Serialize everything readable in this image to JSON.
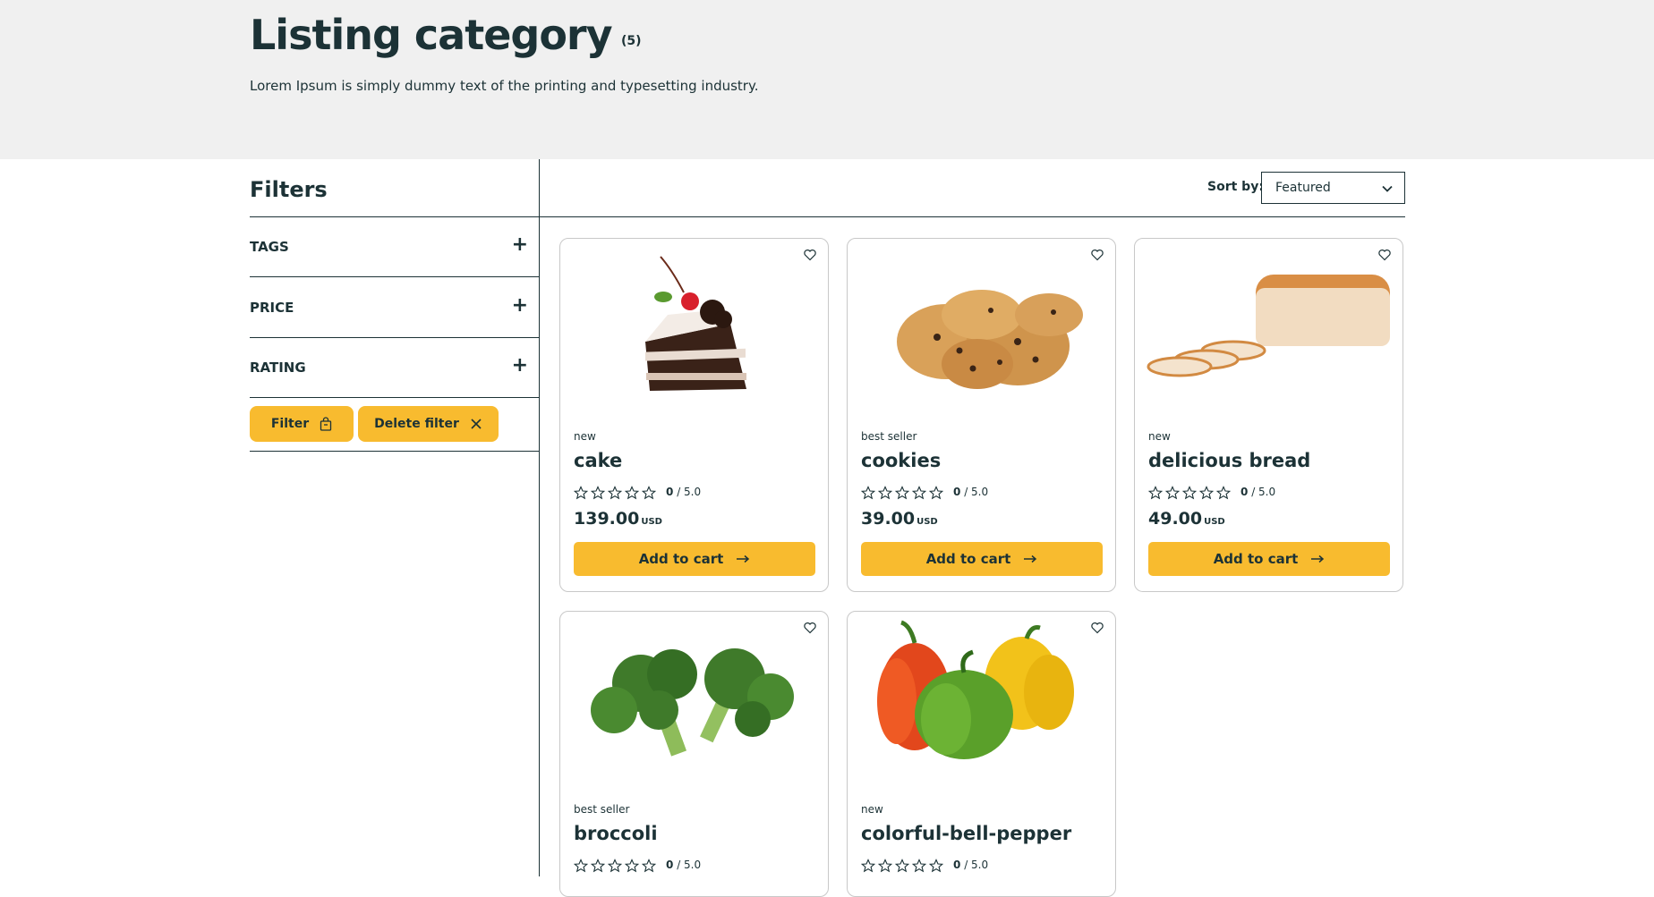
{
  "header": {
    "title": "Listing category",
    "count": "(5)",
    "description": "Lorem Ipsum is simply dummy text of the printing and typesetting industry."
  },
  "filters": {
    "title": "Filters",
    "sections": [
      {
        "label": "TAGS",
        "icon": "plus-icon"
      },
      {
        "label": "PRICE",
        "icon": "plus-icon"
      },
      {
        "label": "RATING",
        "icon": "plus-icon"
      }
    ],
    "filter_button": "Filter",
    "delete_button": "Delete filter"
  },
  "sort": {
    "label": "Sort by:",
    "selected": "Featured"
  },
  "products": [
    {
      "badge": "new",
      "name": "cake",
      "rating": "0",
      "rating_max": "/ 5.0",
      "price": "139.00",
      "currency": "USD",
      "cart_label": "Add to cart"
    },
    {
      "badge": "best seller",
      "name": "cookies",
      "rating": "0",
      "rating_max": "/ 5.0",
      "price": "39.00",
      "currency": "USD",
      "cart_label": "Add to cart"
    },
    {
      "badge": "new",
      "name": "delicious bread",
      "rating": "0",
      "rating_max": "/ 5.0",
      "price": "49.00",
      "currency": "USD",
      "cart_label": "Add to cart"
    },
    {
      "badge": "best seller",
      "name": "broccoli",
      "rating": "0",
      "rating_max": "/ 5.0"
    },
    {
      "badge": "new",
      "name": "colorful-bell-pepper",
      "rating": "0",
      "rating_max": "/ 5.0"
    }
  ],
  "colors": {
    "accent": "#f8bb2f",
    "text": "#1c3236",
    "hero_bg": "#f0f0f0"
  }
}
